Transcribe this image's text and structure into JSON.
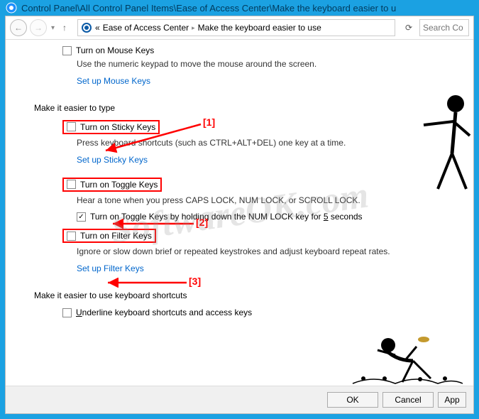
{
  "title_bar": "Control Panel\\All Control Panel Items\\Ease of Access Center\\Make the keyboard easier to u",
  "breadcrumb": {
    "chevron": "«",
    "item1": "Ease of Access Center",
    "item2": "Make the keyboard easier to use"
  },
  "search_placeholder": "Search Co",
  "mouse_keys": {
    "label": "Turn on Mouse Keys",
    "desc": "Use the numeric keypad to move the mouse around the screen.",
    "link": "Set up Mouse Keys"
  },
  "type_section": "Make it easier to type",
  "sticky": {
    "label": "Turn on Sticky Keys",
    "desc": "Press keyboard shortcuts (such as CTRL+ALT+DEL) one key at a time.",
    "link": "Set up Sticky Keys"
  },
  "toggle": {
    "label": "Turn on Toggle Keys",
    "desc": "Hear a tone when you press CAPS LOCK, NUM LOCK, or SCROLL LOCK.",
    "sub_pre": "Turn on Toggle Keys by holding down the NUM LOCK key for ",
    "sub_u": "5",
    "sub_post": " seconds"
  },
  "filter": {
    "label": "Turn on Filter Keys",
    "desc": "Ignore or slow down brief or repeated keystrokes and adjust keyboard repeat rates.",
    "link": "Set up Filter Keys"
  },
  "shortcuts_section": "Make it easier to use keyboard shortcuts",
  "underline_pre": "",
  "underline_u": "U",
  "underline_post": "nderline keyboard shortcuts and access keys",
  "buttons": {
    "ok": "OK",
    "cancel": "Cancel",
    "apply": "App"
  },
  "annotations": {
    "a1": "[1]",
    "a2": "[2]",
    "a3": "[3]"
  },
  "watermark": "SoftwareOK.com"
}
